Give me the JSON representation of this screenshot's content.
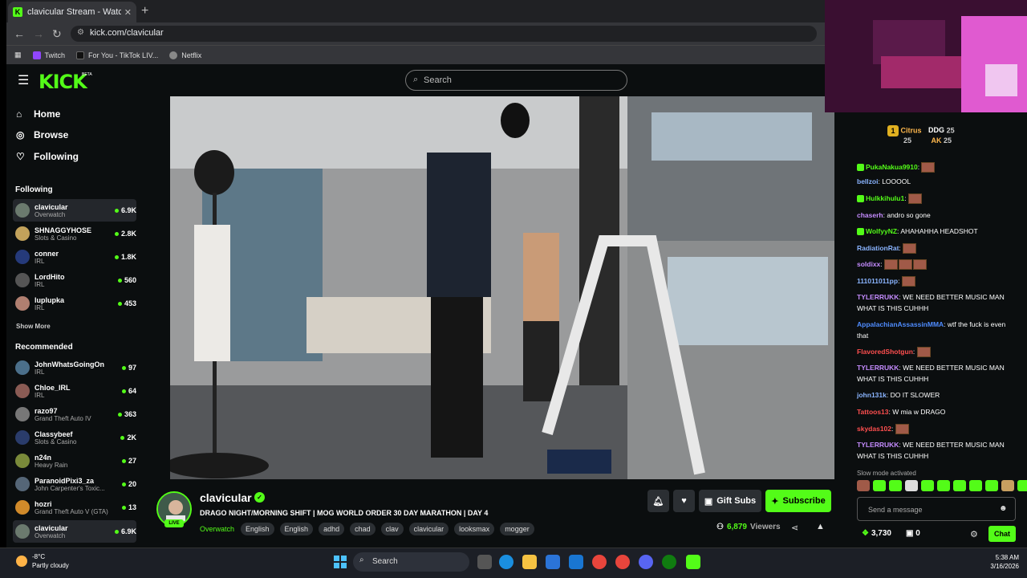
{
  "browser": {
    "tab_title": "clavicular Stream - Watch Live",
    "url": "kick.com/clavicular",
    "bookmarks": [
      {
        "label": "Twitch",
        "color": "#9146ff"
      },
      {
        "label": "For You - TikTok LIV...",
        "color": "#111111"
      },
      {
        "label": "Netflix",
        "color": "#888888"
      }
    ]
  },
  "header": {
    "logo": "KICK",
    "beta": "BETA",
    "search_placeholder": "Search"
  },
  "sidebar": {
    "nav": [
      {
        "label": "Home",
        "icon": "home-icon"
      },
      {
        "label": "Browse",
        "icon": "compass-icon"
      },
      {
        "label": "Following",
        "icon": "heart-icon"
      }
    ],
    "following_title": "Following",
    "following": [
      {
        "name": "clavicular",
        "category": "Overwatch",
        "viewers": "6.9K",
        "color": "#6b7a6e"
      },
      {
        "name": "SHNAGGYHOSE",
        "category": "Slots & Casino",
        "viewers": "2.8K",
        "color": "#c2a25b"
      },
      {
        "name": "conner",
        "category": "IRL",
        "viewers": "1.8K",
        "color": "#253a7a"
      },
      {
        "name": "LordHito",
        "category": "IRL",
        "viewers": "560",
        "color": "#555555"
      },
      {
        "name": "luplupka",
        "category": "IRL",
        "viewers": "453",
        "color": "#b07f70"
      }
    ],
    "show_more": "Show More",
    "recommended_title": "Recommended",
    "recommended": [
      {
        "name": "JohnWhatsGoingOn",
        "category": "IRL",
        "viewers": "97",
        "color": "#4b6f8a"
      },
      {
        "name": "Chloe_IRL",
        "category": "IRL",
        "viewers": "64",
        "color": "#8a5b54"
      },
      {
        "name": "razo97",
        "category": "Grand Theft Auto IV",
        "viewers": "363",
        "color": "#777777"
      },
      {
        "name": "Classybeef",
        "category": "Slots & Casino",
        "viewers": "2K",
        "color": "#2a3c6b"
      },
      {
        "name": "n24n",
        "category": "Heavy Rain",
        "viewers": "27",
        "color": "#7a8a3a"
      },
      {
        "name": "ParanoidPixi3_za",
        "category": "John Carpenter's Toxic...",
        "viewers": "20",
        "color": "#556677"
      },
      {
        "name": "hozri",
        "category": "Grand Theft Auto V (GTA)",
        "viewers": "13",
        "color": "#d08a2a"
      },
      {
        "name": "clavicular",
        "category": "Overwatch",
        "viewers": "6.9K",
        "color": "#6b7a6e"
      }
    ]
  },
  "stream": {
    "streamer": "clavicular",
    "live_label": "LIVE",
    "title": "DRAGO NIGHT/MORNING SHIFT | MOG WORLD ORDER 30 DAY MARATHON | DAY 4",
    "category": "Overwatch",
    "tags": [
      "English",
      "English",
      "adhd",
      "chad",
      "clav",
      "clavicular",
      "looksmax",
      "mogger"
    ],
    "viewers": "6,879",
    "viewers_label": "Viewers",
    "gift_subs_label": "Gift Subs",
    "subscribe_label": "Subscribe"
  },
  "chat": {
    "gifters": [
      {
        "rank": "1",
        "name": "Citrus",
        "count": "25"
      },
      {
        "name": "DDG",
        "count": "25"
      },
      {
        "name": "AK",
        "count": "25"
      }
    ],
    "messages": [
      {
        "user": "PukaNakua9910",
        "color": "#53fc18",
        "text": "",
        "emotes": 1
      },
      {
        "user": "bellzoi",
        "color": "#8ab4ff",
        "text": "LOOOOL",
        "emotes": 0
      },
      {
        "user": "Hulkkihulu1",
        "color": "#53fc18",
        "text": "",
        "emotes": 1
      },
      {
        "user": "chaserh",
        "color": "#c58cff",
        "text": "andro so gone",
        "emotes": 0
      },
      {
        "user": "WolfyyNZ",
        "color": "#53fc18",
        "text": "AHAHAHHA HEADSHOT",
        "emotes": 0
      },
      {
        "user": "RadiationRat",
        "color": "#8ab4ff",
        "text": "",
        "emotes": 1
      },
      {
        "user": "soldixx",
        "color": "#c58cff",
        "text": "",
        "emotes": 3
      },
      {
        "user": "111011011pp",
        "color": "#8ab4ff",
        "text": "",
        "emotes": 1
      },
      {
        "user": "TYLERRUKK",
        "color": "#c58cff",
        "text": "WE NEED BETTER MUSIC MAN WHAT IS THIS CUHHH",
        "emotes": 0
      },
      {
        "user": "AppalachianAssassinMMA",
        "color": "#4f8cff",
        "text": "wtf the fuck is even that",
        "emotes": 0
      },
      {
        "user": "FlavoredShotgun",
        "color": "#ff4f4f",
        "text": "",
        "emotes": 1
      },
      {
        "user": "TYLERRUKK",
        "color": "#c58cff",
        "text": "WE NEED BETTER MUSIC MAN WHAT IS THIS CUHHH",
        "emotes": 0
      },
      {
        "user": "john131k",
        "color": "#8ab4ff",
        "text": "DO IT SLOWER",
        "emotes": 0
      },
      {
        "user": "Tattoos13",
        "color": "#ff4f4f",
        "text": "W mia w DRAGO",
        "emotes": 0
      },
      {
        "user": "skydas102",
        "color": "#ff4f4f",
        "text": "",
        "emotes": 1
      },
      {
        "user": "TYLERRUKK",
        "color": "#c58cff",
        "text": "WE NEED BETTER MUSIC MAN WHAT IS THIS CUHHH",
        "emotes": 0
      }
    ],
    "slow_mode": "Slow mode activated",
    "input_placeholder": "Send a message",
    "points": "3,730",
    "gift_count": "0",
    "chat_button": "Chat"
  },
  "taskbar": {
    "temp": "-8°C",
    "weather": "Partly cloudy",
    "search": "Search",
    "time": "5:38 AM",
    "date": "3/16/2026"
  }
}
